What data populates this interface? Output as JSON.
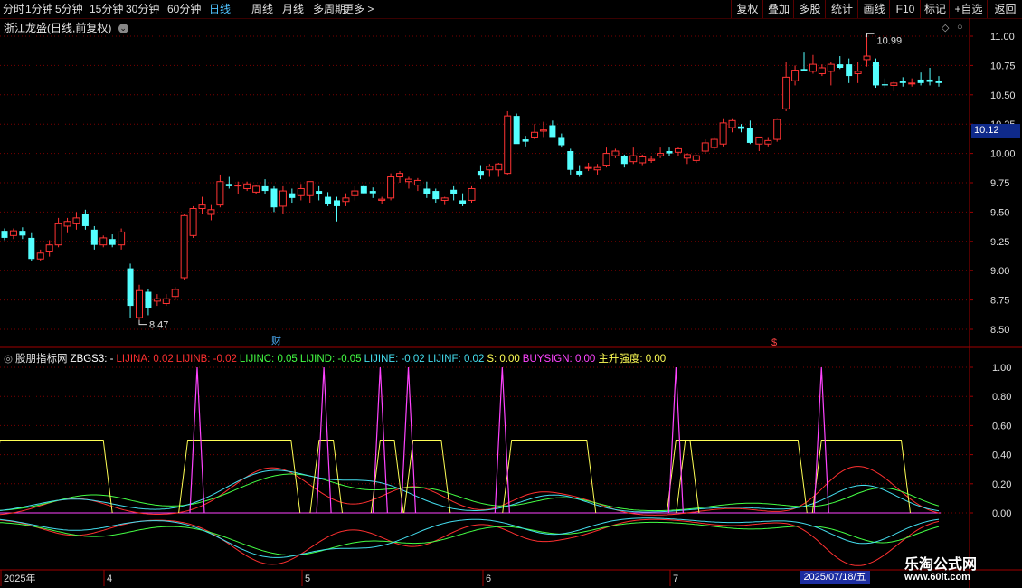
{
  "toolbar": {
    "periods": [
      "分时",
      "1分钟",
      "5分钟",
      "15分钟",
      "30分钟",
      "60分钟",
      "日线",
      "周线",
      "月线",
      "多周期",
      "更多 >"
    ],
    "active_period": "日线",
    "right_buttons": [
      "复权",
      "叠加",
      "多股",
      "统计",
      "画线",
      "F10",
      "标记",
      "+自选",
      "返回"
    ]
  },
  "main_chart": {
    "title": "浙江龙盛(日线,前复权)",
    "price_ticks": [
      "11.00",
      "10.75",
      "10.50",
      "10.25",
      "10.00",
      "9.75",
      "9.50",
      "9.25",
      "9.00",
      "8.75",
      "8.50"
    ],
    "current_price": "10.12",
    "high_label": "10.99",
    "low_label": "8.47",
    "event_marks": [
      "财",
      "$"
    ]
  },
  "indicator": {
    "name": "股朋指标网",
    "values": [
      {
        "text": "ZBGS3: -",
        "color": "#ffffff"
      },
      {
        "text": "LIJINA: 0.02",
        "color": "#ff3030"
      },
      {
        "text": "LIJINB: -0.02",
        "color": "#ff3030"
      },
      {
        "text": "LIJINC: 0.05",
        "color": "#44ff44"
      },
      {
        "text": "LIJIND: -0.05",
        "color": "#44ff44"
      },
      {
        "text": "LIJINE: -0.02",
        "color": "#44ddee"
      },
      {
        "text": "LIJINF: 0.02",
        "color": "#44ddee"
      },
      {
        "text": "S: 0.00",
        "color": "#ffff55"
      },
      {
        "text": "BUYSIGN: 0.00",
        "color": "#ff44ff"
      },
      {
        "text": "主升强度: 0.00",
        "color": "#ffff55"
      }
    ],
    "y_ticks": [
      "1.00",
      "0.80",
      "0.60",
      "0.40",
      "0.20",
      "0.00"
    ]
  },
  "x_axis": {
    "labels": [
      "2025年",
      "4",
      "5",
      "6",
      "7"
    ],
    "cursor_date": "2025/07/18/五"
  },
  "watermark": {
    "line1": "乐淘公式网",
    "line2": "www.60lt.com"
  },
  "colors": {
    "up": "#ff3333",
    "down": "#54ffff",
    "grid": "#7a0000",
    "axis_line": "#a00000"
  },
  "chart_data": [
    {
      "type": "candlestick",
      "title": "浙江龙盛(日线,前复权)",
      "ylim": [
        8.4,
        11.1
      ],
      "candles": [
        [
          9.34,
          9.36,
          9.26,
          9.28
        ],
        [
          9.3,
          9.36,
          9.27,
          9.34
        ],
        [
          9.34,
          9.37,
          9.27,
          9.3
        ],
        [
          9.28,
          9.32,
          9.08,
          9.1
        ],
        [
          9.1,
          9.18,
          9.08,
          9.15
        ],
        [
          9.16,
          9.26,
          9.12,
          9.22
        ],
        [
          9.22,
          9.45,
          9.2,
          9.4
        ],
        [
          9.38,
          9.45,
          9.32,
          9.42
        ],
        [
          9.4,
          9.5,
          9.35,
          9.45
        ],
        [
          9.48,
          9.52,
          9.35,
          9.38
        ],
        [
          9.35,
          9.38,
          9.18,
          9.22
        ],
        [
          9.22,
          9.3,
          9.2,
          9.28
        ],
        [
          9.27,
          9.31,
          9.2,
          9.22
        ],
        [
          9.22,
          9.36,
          9.18,
          9.33
        ],
        [
          9.02,
          9.06,
          8.6,
          8.7
        ],
        [
          8.6,
          8.88,
          8.58,
          8.83
        ],
        [
          8.82,
          8.84,
          8.62,
          8.68
        ],
        [
          8.74,
          8.8,
          8.7,
          8.76
        ],
        [
          8.72,
          8.8,
          8.7,
          8.76
        ],
        [
          8.78,
          8.86,
          8.75,
          8.84
        ],
        [
          8.94,
          9.48,
          8.92,
          9.47
        ],
        [
          9.3,
          9.55,
          9.28,
          9.53
        ],
        [
          9.53,
          9.63,
          9.48,
          9.56
        ],
        [
          9.48,
          9.56,
          9.43,
          9.52
        ],
        [
          9.56,
          9.82,
          9.54,
          9.76
        ],
        [
          9.74,
          9.8,
          9.7,
          9.72
        ],
        [
          9.73,
          9.76,
          9.65,
          9.73
        ],
        [
          9.7,
          9.76,
          9.68,
          9.74
        ],
        [
          9.67,
          9.73,
          9.65,
          9.72
        ],
        [
          9.72,
          9.78,
          9.65,
          9.68
        ],
        [
          9.7,
          9.72,
          9.5,
          9.54
        ],
        [
          9.55,
          9.72,
          9.48,
          9.68
        ],
        [
          9.66,
          9.7,
          9.58,
          9.62
        ],
        [
          9.64,
          9.74,
          9.6,
          9.7
        ],
        [
          9.64,
          9.76,
          9.58,
          9.76
        ],
        [
          9.68,
          9.72,
          9.6,
          9.65
        ],
        [
          9.63,
          9.67,
          9.55,
          9.57
        ],
        [
          9.6,
          9.63,
          9.42,
          9.55
        ],
        [
          9.59,
          9.66,
          9.55,
          9.62
        ],
        [
          9.64,
          9.72,
          9.6,
          9.68
        ],
        [
          9.72,
          9.73,
          9.65,
          9.66
        ],
        [
          9.68,
          9.71,
          9.62,
          9.66
        ],
        [
          9.6,
          9.63,
          9.57,
          9.61
        ],
        [
          9.62,
          9.83,
          9.6,
          9.8
        ],
        [
          9.8,
          9.85,
          9.75,
          9.83
        ],
        [
          9.76,
          9.8,
          9.7,
          9.78
        ],
        [
          9.73,
          9.79,
          9.68,
          9.77
        ],
        [
          9.7,
          9.76,
          9.62,
          9.65
        ],
        [
          9.68,
          9.7,
          9.58,
          9.61
        ],
        [
          9.6,
          9.63,
          9.56,
          9.62
        ],
        [
          9.69,
          9.72,
          9.6,
          9.65
        ],
        [
          9.6,
          9.66,
          9.55,
          9.57
        ],
        [
          9.6,
          9.72,
          9.58,
          9.7
        ],
        [
          9.85,
          9.9,
          9.78,
          9.81
        ],
        [
          9.86,
          9.91,
          9.8,
          9.89
        ],
        [
          9.86,
          9.92,
          9.8,
          9.91
        ],
        [
          9.83,
          10.36,
          9.82,
          10.32
        ],
        [
          10.32,
          10.34,
          10.1,
          10.08
        ],
        [
          10.12,
          10.15,
          10.06,
          10.1
        ],
        [
          10.14,
          10.25,
          10.12,
          10.18
        ],
        [
          10.19,
          10.27,
          10.14,
          10.2
        ],
        [
          10.24,
          10.28,
          10.15,
          10.14
        ],
        [
          10.14,
          10.17,
          10.05,
          10.07
        ],
        [
          10.02,
          10.04,
          9.82,
          9.86
        ],
        [
          9.85,
          9.9,
          9.8,
          9.82
        ],
        [
          9.88,
          9.92,
          9.85,
          9.88
        ],
        [
          9.86,
          9.91,
          9.82,
          9.88
        ],
        [
          9.9,
          10.05,
          9.88,
          10.0
        ],
        [
          9.98,
          10.04,
          9.96,
          10.02
        ],
        [
          9.98,
          9.99,
          9.88,
          9.91
        ],
        [
          9.93,
          10.05,
          9.91,
          9.98
        ],
        [
          9.92,
          9.99,
          9.9,
          9.97
        ],
        [
          9.94,
          9.98,
          9.92,
          9.95
        ],
        [
          9.98,
          10.05,
          9.96,
          10.0
        ],
        [
          10.02,
          10.05,
          9.98,
          10.0
        ],
        [
          10.01,
          10.05,
          9.98,
          10.04
        ],
        [
          9.96,
          10.0,
          9.91,
          9.99
        ],
        [
          9.94,
          9.99,
          9.92,
          9.98
        ],
        [
          10.02,
          10.12,
          10.0,
          10.09
        ],
        [
          10.05,
          10.14,
          10.03,
          10.12
        ],
        [
          10.08,
          10.3,
          10.06,
          10.26
        ],
        [
          10.22,
          10.3,
          10.18,
          10.28
        ],
        [
          10.23,
          10.25,
          10.18,
          10.21
        ],
        [
          10.22,
          10.28,
          10.08,
          10.09
        ],
        [
          10.08,
          10.14,
          10.02,
          10.14
        ],
        [
          10.08,
          10.14,
          10.06,
          10.11
        ],
        [
          10.12,
          10.3,
          10.1,
          10.29
        ],
        [
          10.38,
          10.78,
          10.36,
          10.65
        ],
        [
          10.62,
          10.75,
          10.58,
          10.71
        ],
        [
          10.72,
          10.86,
          10.7,
          10.7
        ],
        [
          10.7,
          10.84,
          10.68,
          10.76
        ],
        [
          10.68,
          10.76,
          10.66,
          10.73
        ],
        [
          10.7,
          10.78,
          10.58,
          10.76
        ],
        [
          10.76,
          10.83,
          10.72,
          10.73
        ],
        [
          10.76,
          10.81,
          10.6,
          10.66
        ],
        [
          10.68,
          10.78,
          10.6,
          10.7
        ],
        [
          10.8,
          10.99,
          10.74,
          10.83
        ],
        [
          10.78,
          10.81,
          10.56,
          10.58
        ],
        [
          10.59,
          10.64,
          10.56,
          10.58
        ],
        [
          10.58,
          10.62,
          10.53,
          10.6
        ],
        [
          10.62,
          10.65,
          10.57,
          10.6
        ],
        [
          10.6,
          10.64,
          10.57,
          10.6
        ],
        [
          10.63,
          10.69,
          10.58,
          10.6
        ],
        [
          10.63,
          10.73,
          10.58,
          10.61
        ],
        [
          10.62,
          10.66,
          10.57,
          10.6
        ]
      ]
    },
    {
      "type": "line",
      "title": "股朋指标网 ZBGS3",
      "ylim": [
        -0.4,
        1.1
      ],
      "series": [
        {
          "name": "BUYSIGN",
          "color": "#ff44ff",
          "spike_positions": [
            0.21,
            0.345,
            0.405,
            0.435,
            0.535,
            0.72,
            0.875
          ]
        },
        {
          "name": "S",
          "color": "#ffff55",
          "segments": [
            [
              0.0,
              0.11
            ],
            [
              0.2,
              0.31
            ],
            [
              0.34,
              0.355
            ],
            [
              0.405,
              0.42
            ],
            [
              0.44,
              0.47
            ],
            [
              0.545,
              0.625
            ],
            [
              0.72,
              0.735
            ],
            [
              0.73,
              0.85
            ],
            [
              0.875,
              0.96
            ]
          ],
          "level": 0.5
        },
        {
          "name": "LIJINA",
          "color": "#ff3030"
        },
        {
          "name": "LIJINB",
          "color": "#ff3030"
        },
        {
          "name": "LIJINC",
          "color": "#44ff44"
        },
        {
          "name": "LIJIND",
          "color": "#44ff44"
        },
        {
          "name": "LIJINE",
          "color": "#44ddee"
        },
        {
          "name": "LIJINF",
          "color": "#44ddee"
        }
      ]
    }
  ]
}
